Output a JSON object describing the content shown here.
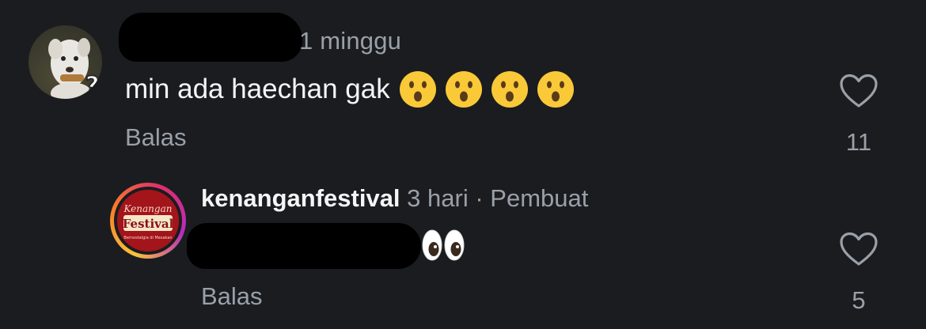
{
  "comment": {
    "time": "1 minggu",
    "text": "min ada haechan gak",
    "emojis": [
      "hushed-face",
      "hushed-face",
      "hushed-face",
      "hushed-face"
    ],
    "reply_label": "Balas",
    "likes": "11"
  },
  "reply": {
    "username": "kenanganfestival",
    "time": "3 hari",
    "separator": "·",
    "creator_label": "Pembuat",
    "emoji": "eyes",
    "reply_label": "Balas",
    "likes": "5",
    "avatar_text": {
      "top": "Kenangan",
      "main": "Festival",
      "bottom": "Bernostalgia di Masakan"
    }
  },
  "colors": {
    "background": "#1a1c20",
    "primary_text": "#f5f5f5",
    "secondary_text": "#9aa0a8",
    "logo_red": "#a3141b"
  }
}
